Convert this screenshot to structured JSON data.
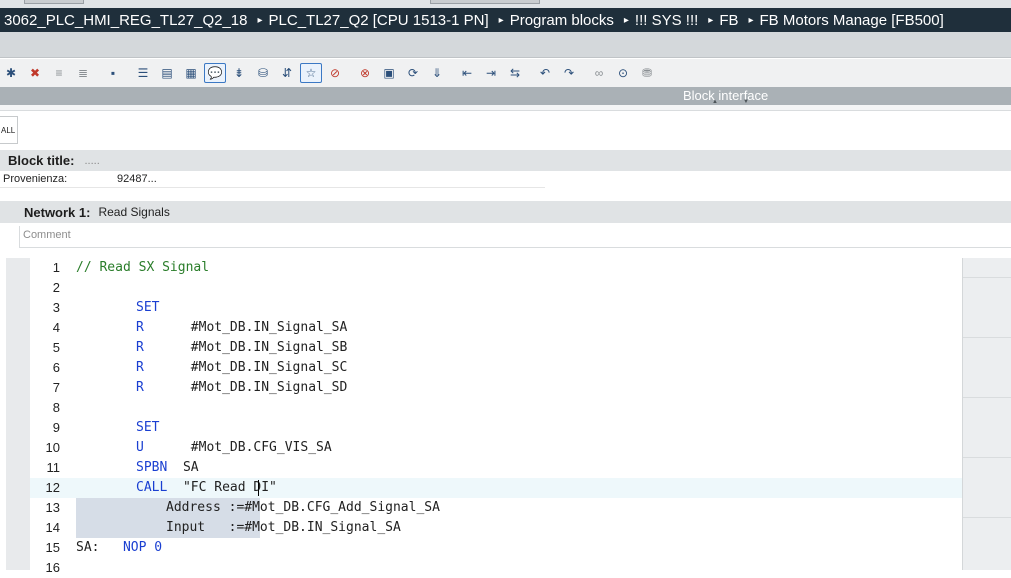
{
  "breadcrumb": {
    "items": [
      "3062_PLC_HMI_REG_TL27_Q2_18",
      "PLC_TL27_Q2 [CPU 1513-1 PN]",
      "Program blocks",
      "!!! SYS !!!",
      "FB",
      "FB Motors Manage [FB500]"
    ],
    "separator": "▸"
  },
  "toolbar": {
    "icons": [
      "insert-network-icon",
      "delete-network-icon",
      "insert-row-icon",
      "add-row-icon",
      "open-all-networks-icon",
      "close-all-networks-icon",
      "absolute-operands-icon",
      "symbolic-operands-icon",
      "comment-icon",
      "insert-comment-icon",
      "monitoring-icon",
      "block-interface-icon",
      "favorites-icon",
      "goto-previous-error-icon",
      "goto-next-error-icon",
      "callstack-icon",
      "update-calls-icon",
      "compile-icon",
      "indent-left-icon",
      "indent-right-icon",
      "replace-icon",
      "undo-icon",
      "redo-icon",
      "monitor-on-icon",
      "monitor-off-icon",
      "download-icon"
    ]
  },
  "interface_panel": {
    "label": "Block interface"
  },
  "call_tab": {
    "label": "ALL"
  },
  "block_title": {
    "label": "Block title:",
    "value": "....."
  },
  "block_properties": {
    "label": "Provenienza:",
    "value": "92487..."
  },
  "network": {
    "label": "Network 1:",
    "title": "Read Signals",
    "comment_placeholder": "Comment"
  },
  "editor": {
    "lines": [
      {
        "num": "1",
        "indent": 0,
        "parts": [
          {
            "t": "// Read SX Signal",
            "c": "cm"
          }
        ]
      },
      {
        "num": "2",
        "indent": 0,
        "parts": []
      },
      {
        "num": "3",
        "indent": 60,
        "parts": [
          {
            "t": "SET",
            "c": "kw"
          }
        ]
      },
      {
        "num": "4",
        "indent": 60,
        "parts": [
          {
            "t": "R",
            "c": "kw"
          },
          {
            "t": "      #Mot_DB.IN_Signal_SA",
            "c": ""
          }
        ]
      },
      {
        "num": "5",
        "indent": 60,
        "parts": [
          {
            "t": "R",
            "c": "kw"
          },
          {
            "t": "      #Mot_DB.IN_Signal_SB",
            "c": ""
          }
        ]
      },
      {
        "num": "6",
        "indent": 60,
        "parts": [
          {
            "t": "R",
            "c": "kw"
          },
          {
            "t": "      #Mot_DB.IN_Signal_SC",
            "c": ""
          }
        ]
      },
      {
        "num": "7",
        "indent": 60,
        "parts": [
          {
            "t": "R",
            "c": "kw"
          },
          {
            "t": "      #Mot_DB.IN_Signal_SD",
            "c": ""
          }
        ]
      },
      {
        "num": "8",
        "indent": 0,
        "parts": []
      },
      {
        "num": "9",
        "indent": 60,
        "parts": [
          {
            "t": "SET",
            "c": "kw"
          }
        ]
      },
      {
        "num": "10",
        "indent": 60,
        "parts": [
          {
            "t": "U",
            "c": "kw"
          },
          {
            "t": "      #Mot_DB.CFG_VIS_SA",
            "c": ""
          }
        ]
      },
      {
        "num": "11",
        "indent": 60,
        "parts": [
          {
            "t": "SPBN",
            "c": "kw"
          },
          {
            "t": "  SA",
            "c": ""
          }
        ]
      },
      {
        "num": "12",
        "indent": 60,
        "parts": [
          {
            "t": "CALL",
            "c": "kw"
          },
          {
            "t": "  \"FC Read DI\"",
            "c": ""
          }
        ]
      },
      {
        "num": "13",
        "indent": 90,
        "parts": [
          {
            "t": "Address :=#Mot_DB.CFG_Add_Signal_SA",
            "c": ""
          }
        ]
      },
      {
        "num": "14",
        "indent": 90,
        "parts": [
          {
            "t": "Input   :=#Mot_DB.IN_Signal_SA",
            "c": ""
          }
        ]
      },
      {
        "num": "15",
        "indent": 0,
        "parts": [
          {
            "t": "SA:",
            "c": ""
          },
          {
            "t": "   NOP",
            "c": "kw"
          },
          {
            "t": " 0",
            "c": "lit"
          }
        ]
      },
      {
        "num": "16",
        "indent": 0,
        "parts": []
      }
    ]
  },
  "colors": {
    "titlebar_bg": "#1f2f3b",
    "keyword": "#1a3fd1",
    "comment": "#2a7d2a",
    "selection": "#d6dde7",
    "current_line": "#eef8fb"
  }
}
